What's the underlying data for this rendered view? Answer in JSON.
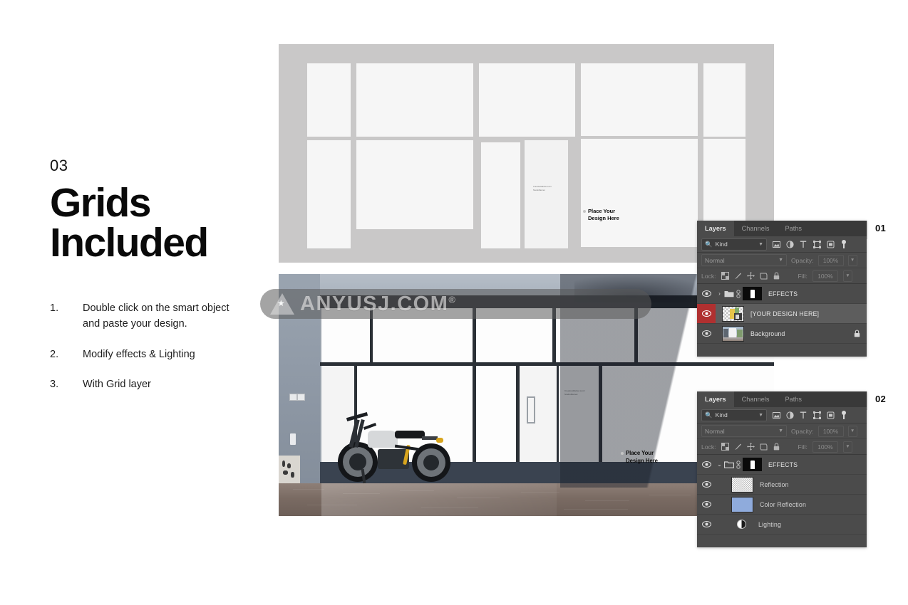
{
  "slide": {
    "step_number": "03",
    "headline_line1": "Grids",
    "headline_line2": "Included",
    "instructions": [
      {
        "num": "1.",
        "text": "Double click on the smart object and paste your design."
      },
      {
        "num": "2.",
        "text": "Modify effects & Lighting"
      },
      {
        "num": "3.",
        "text": "With Grid layer"
      }
    ]
  },
  "watermark": {
    "text": "ANYUSJ.COM",
    "registered_mark": "®",
    "logo_icon": "triangle-star-logo"
  },
  "grid_mockup": {
    "place_your_design": {
      "line1": "Place Your",
      "line2": "Design Here"
    },
    "door_credit": {
      "line1": "CreativeMarket.com/",
      "line2": "StudioDarnec"
    }
  },
  "photo_mockup": {
    "place_your_design": {
      "line1": "Place Your",
      "line2": "Design Here"
    },
    "door_credit": {
      "line1": "CreativeMarket.com/",
      "line2": "StudioDarnec"
    }
  },
  "panels": [
    {
      "badge": "01",
      "tabs": [
        {
          "label": "Layers",
          "active": true
        },
        {
          "label": "Channels",
          "active": false
        },
        {
          "label": "Paths",
          "active": false
        }
      ],
      "filter": {
        "kind_label": "Kind",
        "search_icon": "search-icon",
        "chevron_icon": "chevron-down-icon",
        "type_filters": [
          "pixel-layer-icon",
          "adjustment-layer-icon",
          "type-layer-icon",
          "shape-layer-icon",
          "smart-object-icon",
          "filter-toggle-icon"
        ]
      },
      "blend": {
        "mode": "Normal",
        "opacity_label": "Opacity:",
        "opacity_value": "100%"
      },
      "lock": {
        "label": "Lock:",
        "icons": [
          "lock-transparency-icon",
          "lock-image-icon",
          "lock-position-icon",
          "lock-nesting-icon",
          "lock-all-icon"
        ],
        "fill_label": "Fill:",
        "fill_value": "100%"
      },
      "layers": [
        {
          "name": "EFFECTS",
          "type": "group",
          "expanded": false,
          "visible": true,
          "selected": false,
          "has_mask": true,
          "linked": true,
          "locked": false
        },
        {
          "name": "[YOUR DESIGN HERE]",
          "type": "smart-object",
          "visible": true,
          "selected": true,
          "thumb": "checker-design",
          "locked": false
        },
        {
          "name": "Background",
          "type": "image",
          "visible": true,
          "selected": false,
          "thumb": "photo",
          "locked": true
        }
      ]
    },
    {
      "badge": "02",
      "tabs": [
        {
          "label": "Layers",
          "active": true
        },
        {
          "label": "Channels",
          "active": false
        },
        {
          "label": "Paths",
          "active": false
        }
      ],
      "filter": {
        "kind_label": "Kind",
        "search_icon": "search-icon",
        "chevron_icon": "chevron-down-icon",
        "type_filters": [
          "pixel-layer-icon",
          "adjustment-layer-icon",
          "type-layer-icon",
          "shape-layer-icon",
          "smart-object-icon",
          "filter-toggle-icon"
        ]
      },
      "blend": {
        "mode": "Normal",
        "opacity_label": "Opacity:",
        "opacity_value": "100%"
      },
      "lock": {
        "label": "Lock:",
        "icons": [
          "lock-transparency-icon",
          "lock-image-icon",
          "lock-position-icon",
          "lock-nesting-icon",
          "lock-all-icon"
        ],
        "fill_label": "Fill:",
        "fill_value": "100%"
      },
      "layers": [
        {
          "name": "EFFECTS",
          "type": "group",
          "expanded": true,
          "visible": true,
          "selected": false,
          "has_mask": true,
          "linked": true,
          "locked": false
        },
        {
          "name": "Reflection",
          "type": "image",
          "visible": true,
          "selected": false,
          "thumb": "checker-fine",
          "locked": false
        },
        {
          "name": "Color Reflection",
          "type": "image",
          "visible": true,
          "selected": false,
          "thumb": "solid-blue",
          "locked": false
        },
        {
          "name": "Lighting",
          "type": "adjustment",
          "visible": true,
          "selected": false,
          "thumb": "half-circle",
          "locked": false
        }
      ]
    }
  ],
  "colors": {
    "panel_bg": "#4b4b4b",
    "panel_tabbar": "#393939",
    "selected_row": "#5d5d5d",
    "visibility_active": "#b03030",
    "grid_bg": "#c9c8c8",
    "grid_cell": "#f6f6f6",
    "color_reflection_swatch": "#8fabdc",
    "text_dark": "#0a0a0a"
  }
}
